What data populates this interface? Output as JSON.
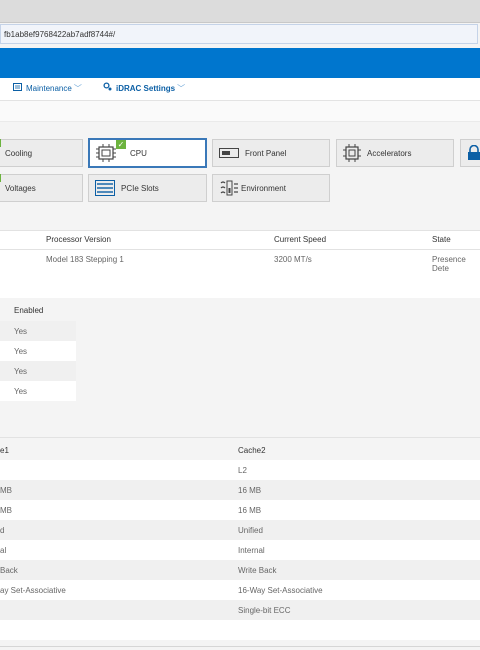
{
  "browser": {
    "url": "fb1ab8ef9768422ab7adf8744#/"
  },
  "nav": {
    "maintenance_label": "Maintenance",
    "idrac_settings_label": "iDRAC Settings"
  },
  "tiles": {
    "cooling": "Cooling",
    "cpu": "CPU",
    "front_panel": "Front Panel",
    "accelerators": "Accelerators",
    "voltages": "Voltages",
    "pcie_slots": "PCIe Slots",
    "environment": "Environment"
  },
  "processor_table": {
    "headers": {
      "version": "Processor Version",
      "speed": "Current Speed",
      "state": "State"
    },
    "row": {
      "version": "Model 183 Stepping 1",
      "speed": "3200 MT/s",
      "state": "Presence Dete"
    }
  },
  "features": {
    "header": "Enabled",
    "values": [
      "Yes",
      "Yes",
      "Yes",
      "Yes"
    ]
  },
  "cache": {
    "headers": {
      "cache1": "e1",
      "cache2": "Cache2"
    },
    "rows": [
      {
        "c1": "",
        "c2": "L2"
      },
      {
        "c1": "MB",
        "c2": "16 MB"
      },
      {
        "c1": "MB",
        "c2": "16 MB"
      },
      {
        "c1": "d",
        "c2": "Unified"
      },
      {
        "c1": "al",
        "c2": "Internal"
      },
      {
        "c1": "Back",
        "c2": "Write Back"
      },
      {
        "c1": "ay Set-Associative",
        "c2": "16-Way Set-Associative"
      },
      {
        "c1": "",
        "c2": "Single-bit ECC"
      }
    ]
  },
  "colors": {
    "brand": "#0076ce",
    "accent_link": "#0b5fa5",
    "status_green": "#6cb33f"
  }
}
